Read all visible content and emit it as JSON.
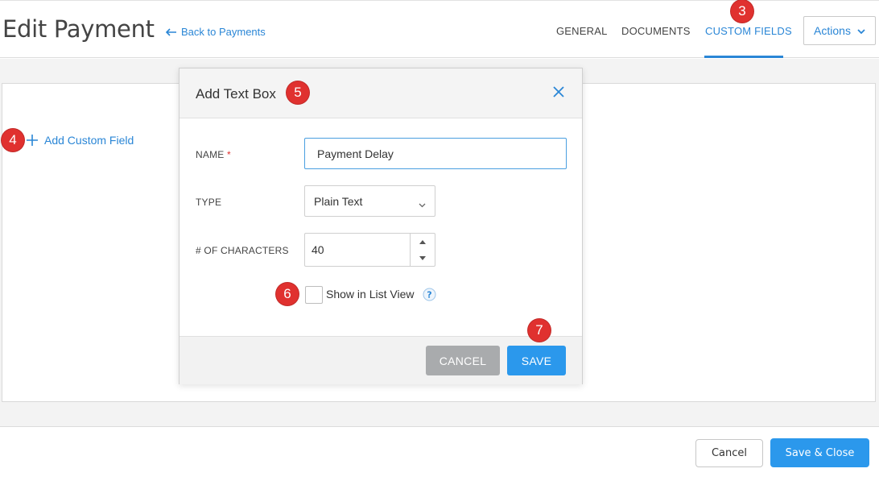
{
  "header": {
    "title": "Edit Payment",
    "back_link": "Back to Payments",
    "tabs": [
      {
        "label": "GENERAL",
        "active": false
      },
      {
        "label": "DOCUMENTS",
        "active": false
      },
      {
        "label": "CUSTOM FIELDS",
        "active": true
      }
    ],
    "actions_label": "Actions"
  },
  "main": {
    "add_custom_field": "Add Custom Field"
  },
  "modal": {
    "title": "Add Text Box",
    "name_label": "NAME",
    "required_mark": "*",
    "name_value": "Payment Delay",
    "type_label": "TYPE",
    "type_value": "Plain Text",
    "chars_label": "# OF CHARACTERS",
    "chars_value": "40",
    "show_list_view_label": "Show in List View",
    "show_list_view_checked": false,
    "cancel_label": "CANCEL",
    "save_label": "SAVE"
  },
  "footer": {
    "cancel_label": "Cancel",
    "save_close_label": "Save & Close"
  },
  "badges": {
    "tabs": "3",
    "add_field": "4",
    "modal_title": "5",
    "checkbox": "6",
    "save": "7"
  },
  "colors": {
    "accent": "#2a86d6",
    "primary_button": "#2b98ec",
    "cancel_button": "#a9abad",
    "badge": "#e0312f"
  },
  "icons": {
    "back": "arrow-left-icon",
    "actions": "chevron-down-icon",
    "add": "plus-icon",
    "close": "close-icon",
    "select": "chevron-down-icon",
    "stepper_up": "caret-up-icon",
    "stepper_down": "caret-down-icon",
    "help": "help-icon"
  }
}
